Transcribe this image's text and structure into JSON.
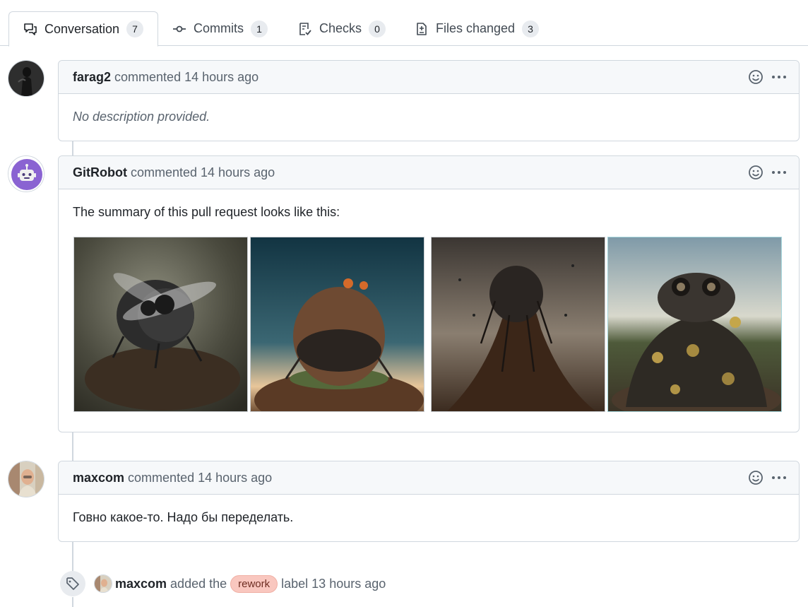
{
  "tabs": [
    {
      "label": "Conversation",
      "count": "7",
      "icon": "comment-discussion-icon"
    },
    {
      "label": "Commits",
      "count": "1",
      "icon": "git-commit-icon"
    },
    {
      "label": "Checks",
      "count": "0",
      "icon": "checklist-icon"
    },
    {
      "label": "Files changed",
      "count": "3",
      "icon": "file-diff-icon"
    }
  ],
  "comments": [
    {
      "author": "farag2",
      "meta": "commented 14 hours ago",
      "body": "No description provided."
    },
    {
      "author": "GitRobot",
      "meta": "commented 14 hours ago",
      "body": "The summary of this pull request looks like this:"
    },
    {
      "author": "maxcom",
      "meta": "commented 14 hours ago",
      "body": "Говно какое-то. Надо бы переделать."
    }
  ],
  "event": {
    "author": "maxcom",
    "action": "added the",
    "label_name": "rework",
    "suffix": "label 13 hours ago",
    "icon": "tag-icon"
  },
  "colors": {
    "label_bg": "#f9c7bf",
    "robot_avatar": "#8a63d2"
  }
}
